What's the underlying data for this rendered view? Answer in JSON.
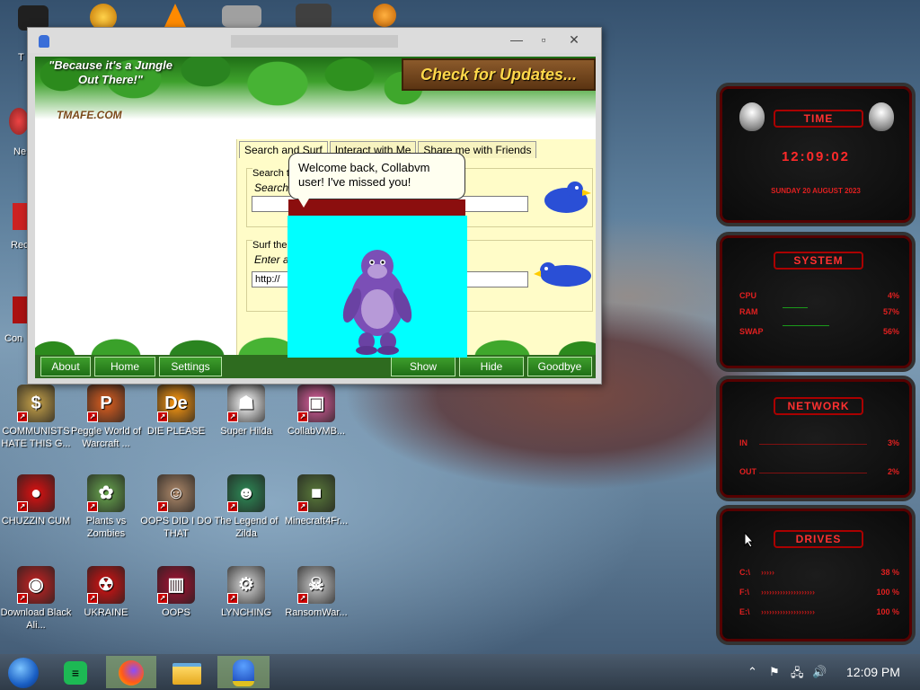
{
  "desktop_icons": [
    {
      "name": "icon-communists",
      "label": "COMMUNISTS HATE THIS G...",
      "glyph": "$",
      "color": "#c9a44a"
    },
    {
      "name": "icon-peggle",
      "label": "Peggle World of Warcraft ...",
      "glyph": "P",
      "color": "#e06020"
    },
    {
      "name": "icon-die-please",
      "label": "DIE PLEASE",
      "glyph": "De",
      "color": "#ff9a10"
    },
    {
      "name": "icon-super-hilda",
      "label": "Super Hilda",
      "glyph": "☗",
      "color": "#ffffff"
    },
    {
      "name": "icon-collabvmb",
      "label": "CollabVMB...",
      "glyph": "▣",
      "color": "#e060a0"
    },
    {
      "name": "icon-chuzzin",
      "label": "CHUZZIN CUM",
      "glyph": "●",
      "color": "#e01010"
    },
    {
      "name": "icon-plants",
      "label": "Plants vs Zombies",
      "glyph": "✿",
      "color": "#6aa84f"
    },
    {
      "name": "icon-oops-did",
      "label": "OOPS DID I DO THAT",
      "glyph": "☺",
      "color": "#b08a6a"
    },
    {
      "name": "icon-zilda",
      "label": "The Legend of Zilda",
      "glyph": "☻",
      "color": "#2e8b57"
    },
    {
      "name": "icon-minecraft",
      "label": "Minecraft4Fr...",
      "glyph": "■",
      "color": "#5a7a3a"
    },
    {
      "name": "icon-download-black",
      "label": "Download Black Ali...",
      "glyph": "◉",
      "color": "#cc2222"
    },
    {
      "name": "icon-ukraine",
      "label": "UKRAINE",
      "glyph": "☢",
      "color": "#dd1111"
    },
    {
      "name": "icon-oops",
      "label": "OOPS",
      "glyph": "▥",
      "color": "#aa1133"
    },
    {
      "name": "icon-lynching",
      "label": "LYNCHING",
      "glyph": "⚙",
      "color": "#dddddd"
    },
    {
      "name": "icon-ransomware",
      "label": "RansomWar...",
      "glyph": "☠",
      "color": "#cccccc"
    }
  ],
  "left_partial_labels": [
    "T",
    "Ne",
    "Rec",
    "Con"
  ],
  "window": {
    "title": "",
    "slogan": "\"Because it's a Jungle Out There!\"",
    "brand": "TMAFE.COM",
    "update_button": "Check for Updates...",
    "tabs": [
      "Search and Surf",
      "Interact with Me",
      "Share me with Friends"
    ],
    "search_label": "Search t",
    "search_hint": "Search",
    "search_value": "",
    "surf_label": "Surf the",
    "surf_hint": "Enter a",
    "surf_value": "http://",
    "buttons_left": [
      "About",
      "Home",
      "Settings"
    ],
    "buttons_right": [
      "Show",
      "Hide",
      "Goodbye"
    ]
  },
  "bonzi": {
    "message": "Welcome back, Collabvm user! I've missed you!"
  },
  "gadget": {
    "time_title": "TIME",
    "time_value": "12:09:02",
    "date_value": "SUNDAY 20 AUGUST 2023",
    "system_title": "SYSTEM",
    "system_rows": [
      {
        "label": "CPU",
        "value": "4%"
      },
      {
        "label": "RAM",
        "value": "57%"
      },
      {
        "label": "SWAP",
        "value": "56%"
      }
    ],
    "network_title": "NETWORK",
    "network_rows": [
      {
        "label": "IN",
        "value": "3%"
      },
      {
        "label": "OUT",
        "value": "2%"
      }
    ],
    "drives_title": "DRIVES",
    "drive_rows": [
      {
        "label": "C:\\",
        "value": "38 %"
      },
      {
        "label": "F:\\",
        "value": "100 %"
      },
      {
        "label": "E:\\",
        "value": "100 %"
      }
    ]
  },
  "taskbar": {
    "clock": "12:09 PM",
    "items": [
      "start-orb",
      "notes-app",
      "firefox",
      "file-explorer",
      "bonzi-app"
    ]
  },
  "colors": {
    "accent_red": "#e02020",
    "jungle_green": "#2e8b22",
    "panel_yellow": "#fffcc8",
    "cyan": "#00ffff"
  }
}
